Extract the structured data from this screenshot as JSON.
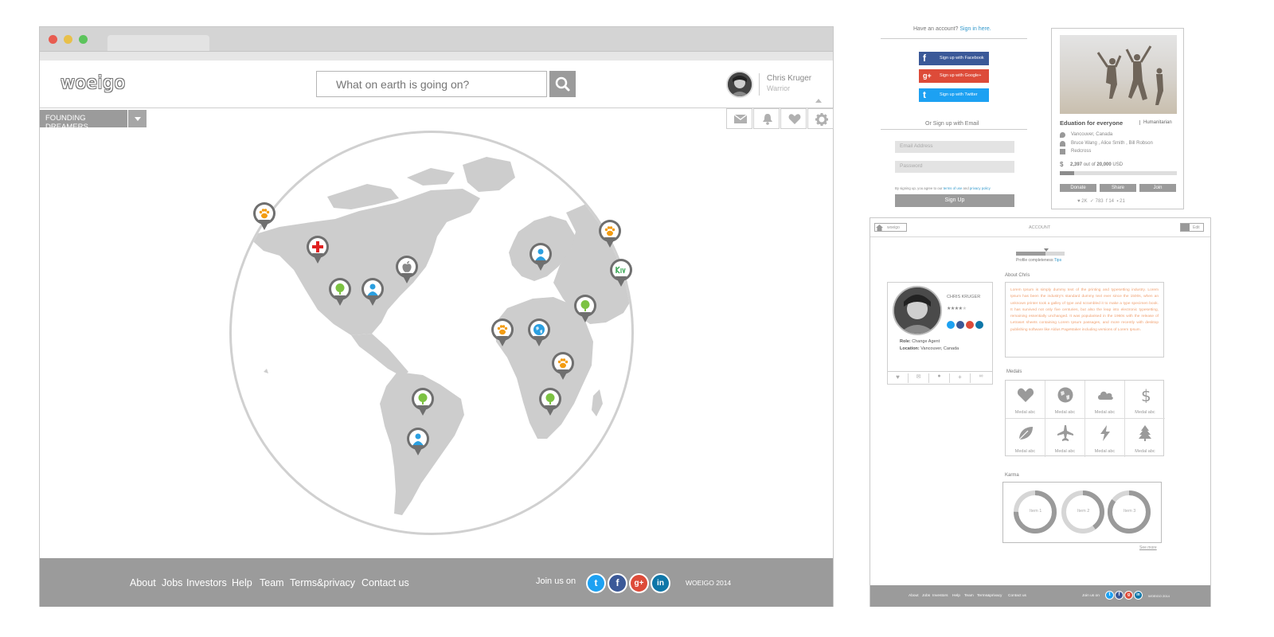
{
  "browser": {
    "logo": "woeigo",
    "search_placeholder": "What on earth is going on?",
    "user": {
      "name": "Chris Kruger",
      "role": "Warrior"
    },
    "group_dropdown": "FOUNDING DREAMERS",
    "toolbar_icons": [
      "envelope-icon",
      "bell-icon",
      "heart-icon",
      "gear-icon"
    ],
    "map_pins": [
      "paw",
      "red-cross",
      "tree",
      "person",
      "apple",
      "person",
      "paw",
      "kiva",
      "paw",
      "globe",
      "tree",
      "paw",
      "tree",
      "tree",
      "person"
    ],
    "footer": {
      "links": [
        "About",
        "Jobs",
        "Investors",
        "Help",
        "Team",
        "Terms&privacy",
        "Contact us"
      ],
      "join_label": "Join us on",
      "social": [
        "twitter",
        "facebook",
        "google-plus",
        "linkedin"
      ],
      "copyright": "WOEIGO 2014"
    }
  },
  "signup": {
    "have_account": "Have an account?",
    "sign_in_link": "Sign in here.",
    "facebook": "Sign up with Facebook",
    "google": "Sign up with Google+",
    "twitter": "Sign up with Twitter",
    "or_email": "Or Sign up with Email",
    "email_placeholder": "Email Address",
    "password_placeholder": "Password",
    "terms_prefix": "By signing up, you agree to our",
    "terms_link": "terms of use",
    "terms_and": "and",
    "privacy_link": "privacy policy",
    "button": "Sign Up"
  },
  "card": {
    "title": "Eduation for everyone",
    "category": "Humanitarian",
    "location": "Vancouver, Canada",
    "people": "Bruce Wang , Alice Smith , Bill Robson",
    "org": "Redcross",
    "raised": "2,397",
    "out_of": "out of",
    "goal": "20,000",
    "currency": "USD",
    "progress": 0.12,
    "buttons": [
      "Donate",
      "Share",
      "Join"
    ],
    "stats": {
      "likes": "2K",
      "tweets": "783",
      "facebook": "14",
      "comments": "21"
    }
  },
  "account": {
    "logo_small": "woeigo",
    "title": "ACCOUNT",
    "edit": "Edit",
    "completeness_label": "Profile completeness:",
    "completeness_tips": "Tips",
    "completeness": 0.6,
    "about_heading": "About Chris",
    "about_text": "Lorem Ipsum is simply dummy text of the printing and typesetting industry. Lorem Ipsum has been the industry's standard dummy text ever since the 1500s, when an unknown printer took a galley of type and scrambled it to make a type specimen book. It has survived not only five centuries, but also the leap into electronic typesetting, remaining essentially unchanged. It was popularised in the 1960s with the release of Letraset sheets containing Lorem Ipsum passages, and more recently with desktop publishing software like Aldus PageMaker including versions of Lorem Ipsum.",
    "name": "CHRIS KRUGER",
    "rating": 4,
    "role_label": "Role:",
    "role": "Change Agent",
    "location_label": "Location:",
    "location": "Vancouver, Canada",
    "medals_heading": "Medals",
    "medals": [
      {
        "icon": "heart-icon",
        "label": "Medal abc"
      },
      {
        "icon": "globe-icon",
        "label": "Medal abc"
      },
      {
        "icon": "cloud-icon",
        "label": "Medal abc"
      },
      {
        "icon": "dollar-icon",
        "label": "Medal abc"
      },
      {
        "icon": "leaf-icon",
        "label": "Medal abc"
      },
      {
        "icon": "plane-icon",
        "label": "Medal abc"
      },
      {
        "icon": "bolt-icon",
        "label": "Medal abc"
      },
      {
        "icon": "tree-icon",
        "label": "Medal abc"
      }
    ],
    "karma_heading": "Karma",
    "karma_items": [
      {
        "label": "Item 1",
        "value": 0.75
      },
      {
        "label": "Item 2",
        "value": 0.4
      },
      {
        "label": "Item 3",
        "value": 0.85
      }
    ],
    "see_more": "See more",
    "footer_links": [
      "About",
      "Jobs",
      "Investors",
      "Help",
      "Team",
      "Terms&privacy",
      "Contact us"
    ],
    "footer_join": "Join us on",
    "footer_copyright": "WOEIGO 2014"
  },
  "colors": {
    "accent_blue": "#3399cc",
    "facebook": "#3b5998",
    "google": "#dd4b39",
    "twitter": "#1da1f2",
    "linkedin": "#0e76a8",
    "pin_orange": "#f39c12",
    "pin_green": "#7cc242",
    "pin_blue": "#2b9fe0",
    "pin_red": "#e02020"
  }
}
